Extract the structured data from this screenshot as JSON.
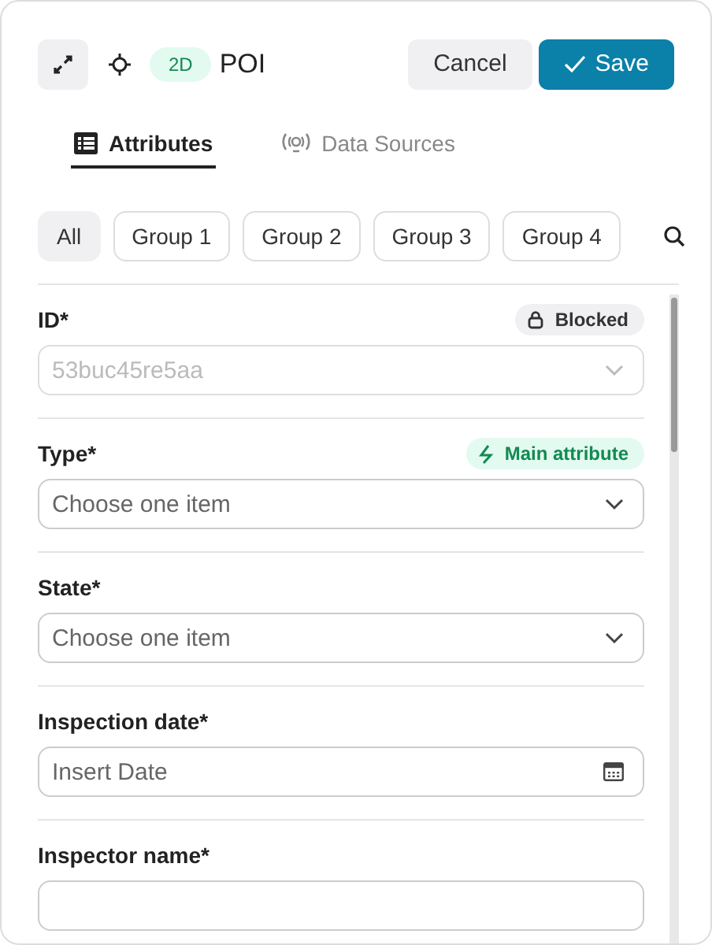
{
  "header": {
    "badge": "2D",
    "title": "POI",
    "buttons": [
      {
        "label": "Cancel",
        "kind": "secondary"
      },
      {
        "label": "Save",
        "kind": "primary"
      }
    ]
  },
  "tabs": [
    {
      "label": "Attributes",
      "selected": true,
      "kind": "list"
    },
    {
      "label": "Data Sources",
      "selected": false,
      "kind": "sensor"
    }
  ],
  "filters": [
    {
      "label": "All",
      "selected": true
    },
    {
      "label": "Group 1",
      "selected": false
    },
    {
      "label": "Group 2",
      "selected": false
    },
    {
      "label": "Group 3",
      "selected": false
    },
    {
      "label": "Group 4",
      "selected": false
    }
  ],
  "fields": [
    {
      "label": "ID*",
      "kind": "select",
      "value": "53buc45re5aa",
      "disabled": true,
      "tag": {
        "kind": "blocked",
        "label": "Blocked"
      }
    },
    {
      "label": "Type*",
      "kind": "select",
      "placeholder": "Choose one item",
      "disabled": false,
      "tag": {
        "kind": "main",
        "label": "Main attribute"
      }
    },
    {
      "label": "State*",
      "kind": "select",
      "placeholder": "Choose one item",
      "disabled": false
    },
    {
      "label": "Inspection date*",
      "kind": "date",
      "placeholder": "Insert Date",
      "disabled": false
    },
    {
      "label": "Inspector name*",
      "kind": "text",
      "disabled": false
    }
  ]
}
